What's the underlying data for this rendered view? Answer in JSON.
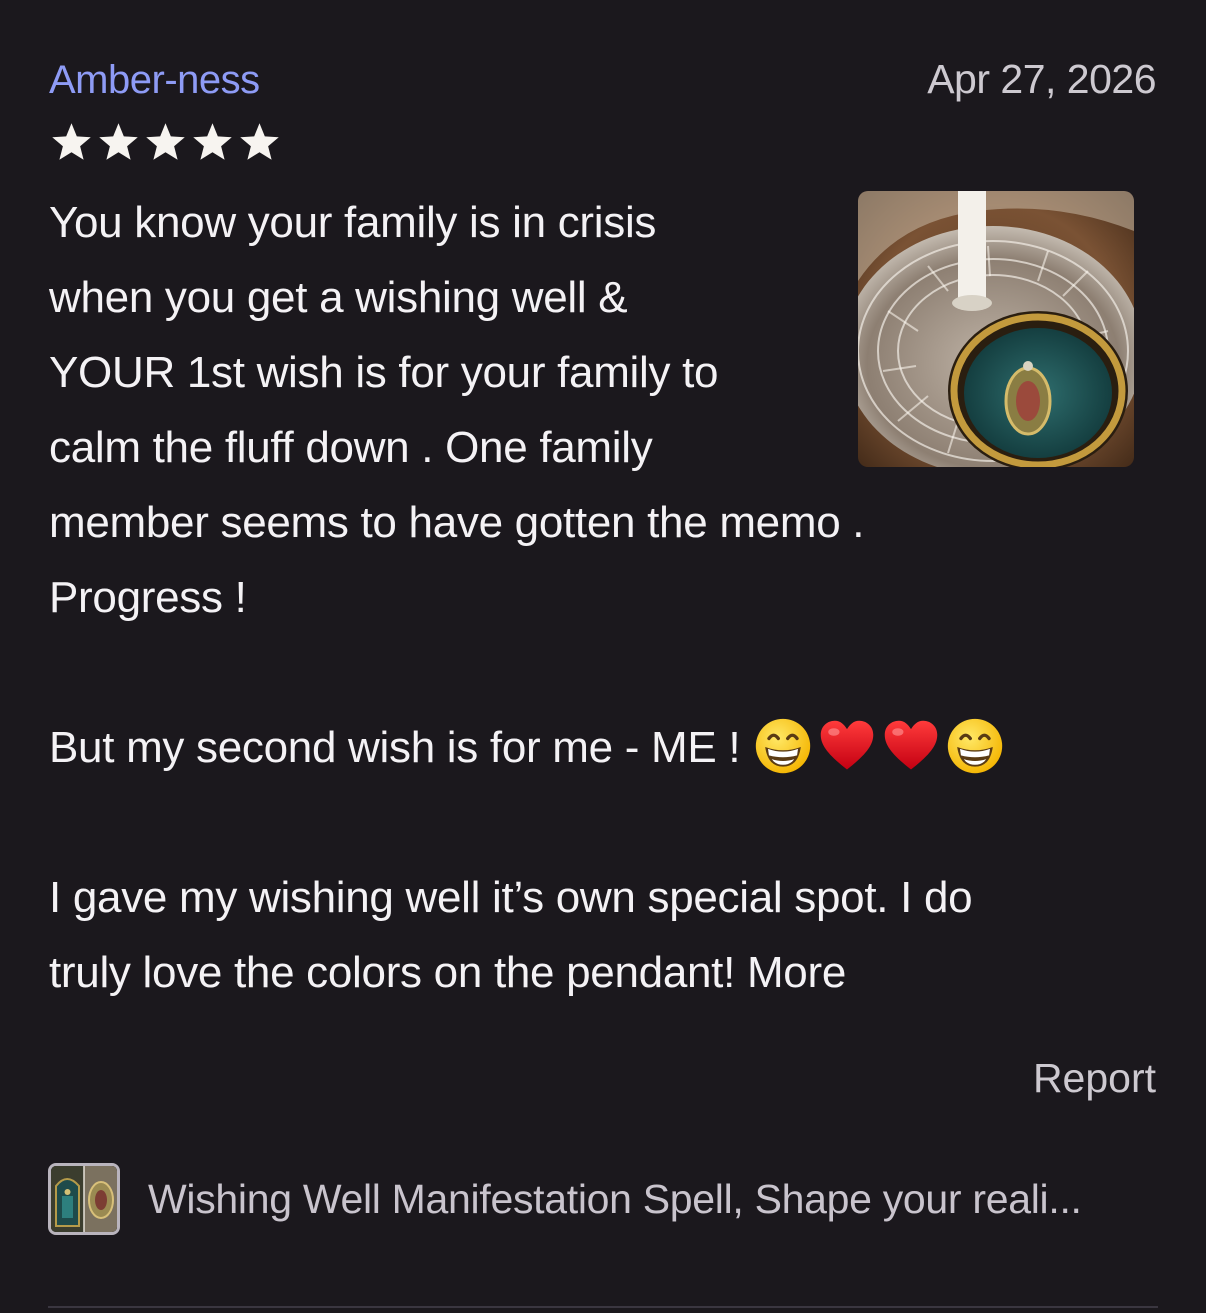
{
  "review": {
    "reviewer_name": "Amber-ness",
    "date": "Apr 27, 2026",
    "rating": 5,
    "rating_max": 5,
    "paragraphs": [
      "You know your family is in crisis",
      "when you get a wishing well &",
      "YOUR 1st wish is for your family to",
      "calm the fluff down . One family",
      "member seems to have gotten the memo .",
      "Progress !"
    ],
    "second_paragraph": "But my second wish is for me - ME ! ",
    "emojis": [
      "grinning-face",
      "red-heart",
      "red-heart",
      "grinning-face"
    ],
    "third_paragraph_line1": "I gave my wishing well it’s own special spot. I do",
    "third_paragraph_line2": "truly love the colors on the pendant! ",
    "more_label": "More",
    "report_label": "Report",
    "photo_icon": "review-photo"
  },
  "product": {
    "title": "Wishing Well Manifestation Spell, Shape your reali...",
    "thumb_icon": "product-thumbnail"
  },
  "colors": {
    "background": "#1b181d",
    "reviewer_link": "#8e9bf5",
    "text": "#f4f2f5",
    "muted": "#cdc9d0",
    "star": "#f7f4f0"
  }
}
